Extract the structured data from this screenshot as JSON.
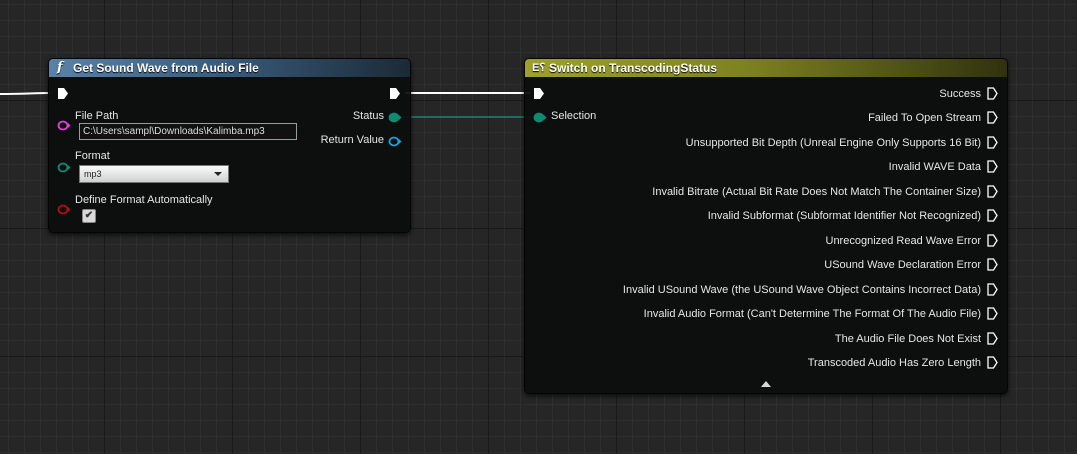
{
  "get_node": {
    "title": "Get Sound Wave from Audio File",
    "icon": "function-icon",
    "inputs": {
      "file_path_label": "File Path",
      "file_path_value": "C:\\Users\\sampl\\Downloads\\Kalimba.mp3",
      "format_label": "Format",
      "format_value": "mp3",
      "define_format_label": "Define Format Automatically",
      "define_format_checked": true
    },
    "outputs": {
      "status_label": "Status",
      "return_value_label": "Return Value"
    }
  },
  "switch_node": {
    "title": "Switch on TranscodingStatus",
    "icon": "switch-enum-icon",
    "selection_label": "Selection",
    "outputs": [
      "Success",
      "Failed To Open Stream",
      "Unsupported Bit Depth (Unreal Engine Only Supports 16 Bit)",
      "Invalid WAVE Data",
      "Invalid Bitrate (Actual Bit Rate Does Not Match The Container Size)",
      "Invalid Subformat (Subformat Identifier Not Recognized)",
      "Unrecognized Read Wave Error",
      "USound Wave Declaration Error",
      "Invalid USound Wave (the USound Wave Object Contains Incorrect Data)",
      "Invalid Audio Format (Can't Determine The Format Of The Audio File)",
      "The Audio File Does Not Exist",
      "Transcoded Audio Has Zero Length"
    ]
  },
  "colors": {
    "string_pin": "#e040e0",
    "byte_pin": "#0f8a72",
    "bool_pin": "#b01010",
    "object_pin": "#1fa0d8",
    "exec_wire": "#ffffff",
    "function_header": "#5a82a8",
    "switch_header": "#9ea12a"
  }
}
